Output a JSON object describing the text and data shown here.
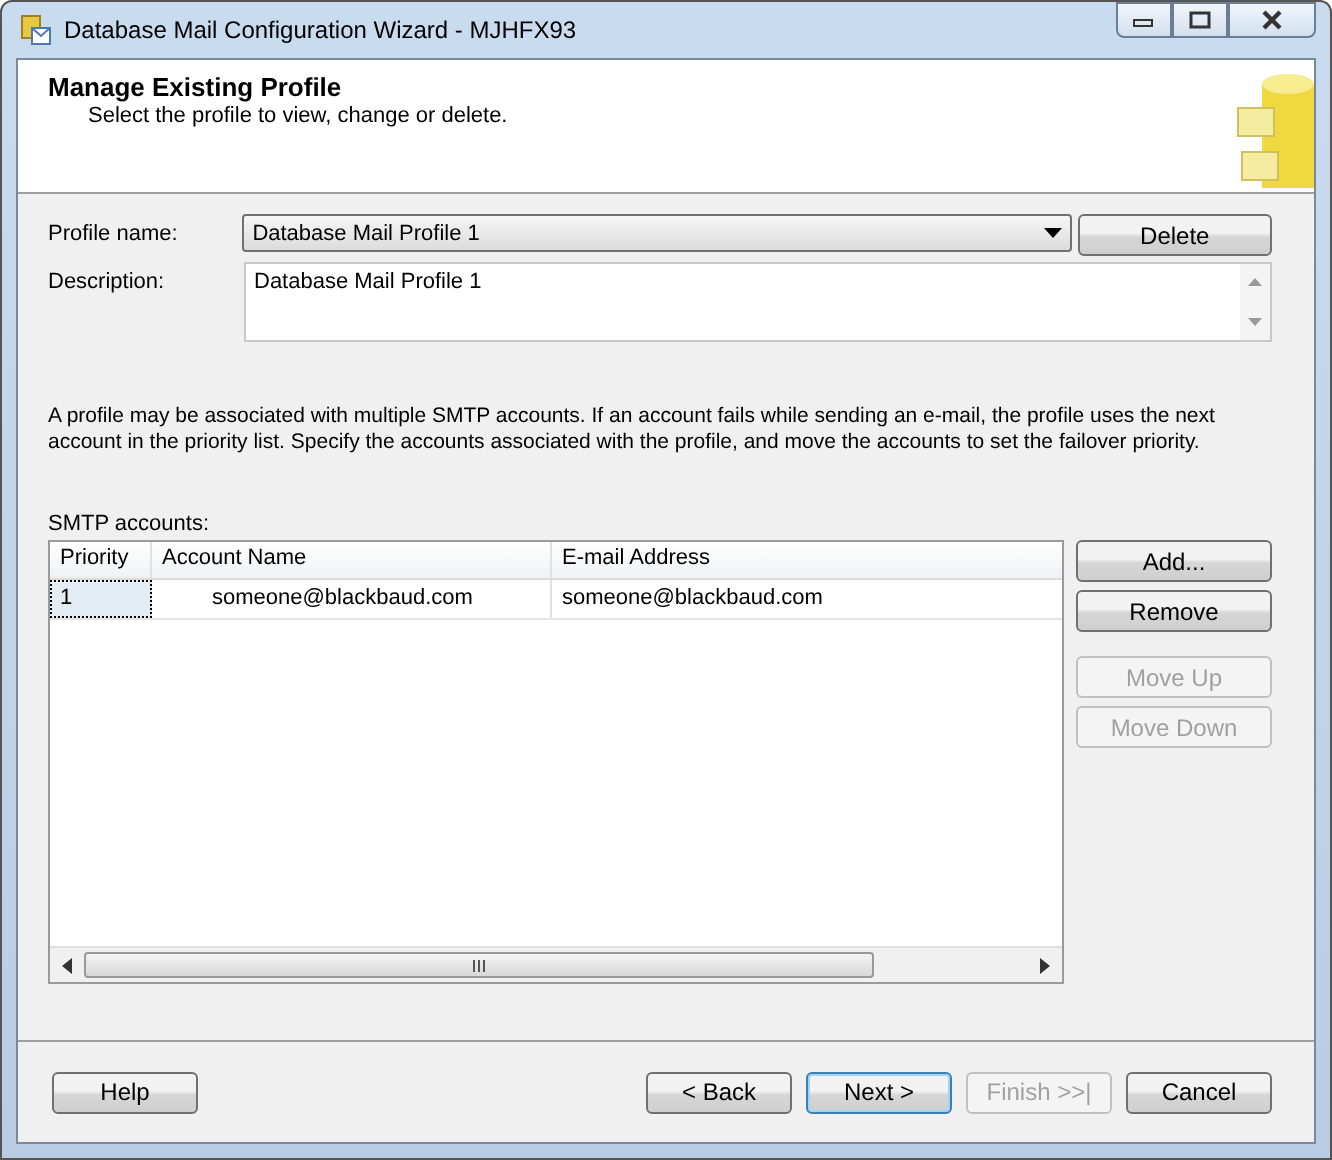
{
  "window": {
    "title": "Database Mail Configuration Wizard - MJHFX93"
  },
  "header": {
    "title": "Manage Existing Profile",
    "subtitle": "Select the profile to view, change or delete."
  },
  "profile_name": {
    "label": "Profile name:",
    "value": "Database Mail Profile 1"
  },
  "delete_button": {
    "label": "Delete",
    "disabled": false
  },
  "description": {
    "label": "Description:",
    "value": "Database Mail Profile 1"
  },
  "info_text": "A profile may be associated with multiple SMTP accounts. If an account fails while sending an e-mail, the profile uses the next account in the priority list. Specify the accounts associated with the profile, and move the accounts to set the failover priority.",
  "smtp_accounts": {
    "label": "SMTP accounts:",
    "columns": [
      "Priority",
      "Account Name",
      "E-mail Address"
    ],
    "rows": [
      {
        "cells": [
          "1",
          "someone@blackbaud.com",
          "someone@blackbaud.com"
        ],
        "focused": true
      }
    ]
  },
  "side_buttons": [
    {
      "label": "Add...",
      "disabled": false
    },
    {
      "label": "Remove",
      "disabled": false
    },
    {
      "label": "Move Up",
      "disabled": true
    },
    {
      "label": "Move Down",
      "disabled": true
    }
  ],
  "footer_buttons": [
    {
      "label": "Help",
      "disabled": false,
      "default": false
    },
    {
      "label": "< Back",
      "disabled": false,
      "default": false
    },
    {
      "label": "Next >",
      "disabled": false,
      "default": true
    },
    {
      "label": "Finish >>|",
      "disabled": true,
      "default": false
    },
    {
      "label": "Cancel",
      "disabled": false,
      "default": false
    }
  ]
}
